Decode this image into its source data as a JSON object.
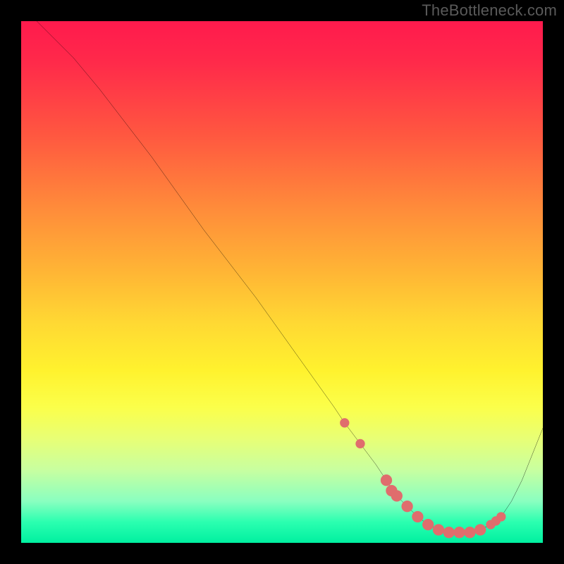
{
  "watermark": "TheBottleneck.com",
  "colors": {
    "background": "#000000",
    "curve": "#000000",
    "marker": "#e06d6d",
    "gradient_top": "#ff1a4d",
    "gradient_bottom": "#00f0a0"
  },
  "chart_data": {
    "type": "line",
    "title": "",
    "xlabel": "",
    "ylabel": "",
    "xlim": [
      0,
      100
    ],
    "ylim": [
      0,
      100
    ],
    "grid": false,
    "legend": false,
    "series": [
      {
        "name": "bottleneck-curve",
        "x": [
          0,
          3,
          6,
          10,
          15,
          20,
          25,
          30,
          35,
          40,
          45,
          50,
          55,
          60,
          62,
          65,
          68,
          70,
          72,
          74,
          76,
          78,
          80,
          82,
          84,
          86,
          88,
          90,
          92,
          94,
          96,
          100
        ],
        "y": [
          102,
          100,
          97,
          93,
          87,
          80.5,
          74,
          67,
          60,
          53.5,
          47,
          40,
          33,
          26,
          23,
          19,
          15,
          12,
          9,
          7,
          5,
          3.5,
          2.5,
          2,
          2,
          2,
          2.5,
          3.5,
          5,
          8,
          12,
          22
        ]
      }
    ],
    "markers": {
      "name": "sweet-spot-dots",
      "color": "#e06d6d",
      "points": [
        {
          "x": 62,
          "y": 23
        },
        {
          "x": 65,
          "y": 19
        },
        {
          "x": 70,
          "y": 12,
          "r": 1.1
        },
        {
          "x": 71,
          "y": 10,
          "r": 1.1
        },
        {
          "x": 72,
          "y": 9,
          "r": 1.1
        },
        {
          "x": 74,
          "y": 7,
          "r": 1.1
        },
        {
          "x": 76,
          "y": 5,
          "r": 1.1
        },
        {
          "x": 78,
          "y": 3.5,
          "r": 1.1
        },
        {
          "x": 80,
          "y": 2.5,
          "r": 1.1
        },
        {
          "x": 82,
          "y": 2,
          "r": 1.1
        },
        {
          "x": 84,
          "y": 2,
          "r": 1.1
        },
        {
          "x": 86,
          "y": 2,
          "r": 1.1
        },
        {
          "x": 88,
          "y": 2.5,
          "r": 1.1
        },
        {
          "x": 90,
          "y": 3.5
        },
        {
          "x": 91,
          "y": 4.2
        },
        {
          "x": 92,
          "y": 5
        }
      ]
    }
  }
}
